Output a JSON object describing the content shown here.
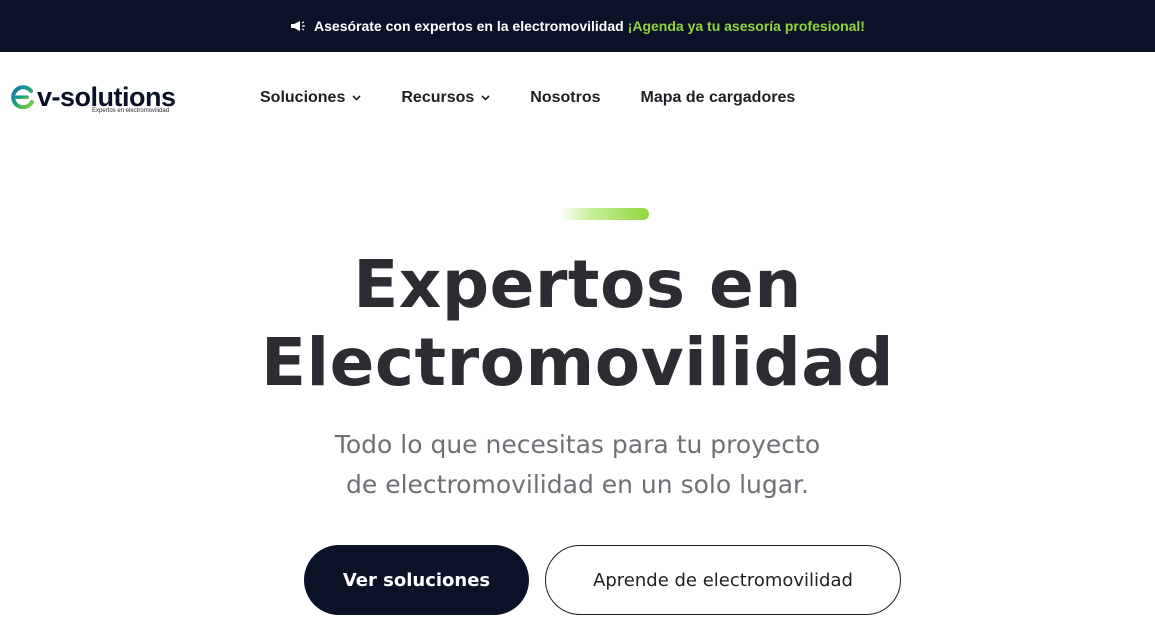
{
  "announcement": {
    "text": "Asesórate con expertos en la electromovilidad",
    "cta": "¡Agenda ya tu asesoría profesional!",
    "icon": "megaphone-icon"
  },
  "brand": {
    "logo_word": "v-solutions",
    "tagline": "Expertos en electromovilidad"
  },
  "nav": {
    "items": [
      {
        "label": "Soluciones",
        "has_dropdown": true
      },
      {
        "label": "Recursos",
        "has_dropdown": true
      },
      {
        "label": "Nosotros",
        "has_dropdown": false
      },
      {
        "label": "Mapa de cargadores",
        "has_dropdown": false
      }
    ]
  },
  "hero": {
    "title_line1": "Expertos en",
    "title_line2": "Electromovilidad",
    "subtitle_line1": "Todo lo que necesitas para tu proyecto",
    "subtitle_line2": "de electromovilidad en un solo lugar.",
    "primary_button": "Ver soluciones",
    "secondary_button": "Aprende de electromovilidad"
  },
  "colors": {
    "navy": "#0b1228",
    "accent_green": "#8fd63a",
    "text_dark": "#2b2d33",
    "text_muted": "#6e7076"
  }
}
